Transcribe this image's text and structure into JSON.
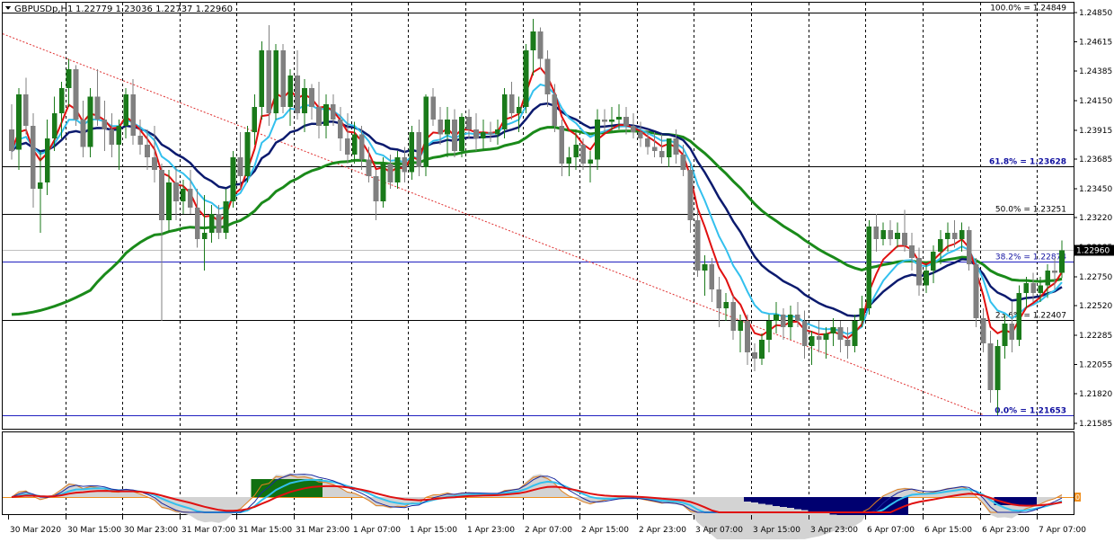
{
  "header": {
    "symbol_label": "GBPUSDp,H1",
    "ohlc_text": "1.22779 1.23036 1.22737 1.22960",
    "menu_arrow": "triangle-down-icon"
  },
  "colors": {
    "bull": "#1a7a1a",
    "bear": "#808080",
    "ma_fast": "#e01010",
    "ma_mid": "#33c0ee",
    "ma_slow": "#0b1a6e",
    "ma_long": "#1a8a1a",
    "trend": "#e03030",
    "fib_label": "#1010a0",
    "grid": "#000000"
  },
  "price_axis": {
    "ticks": [
      "1.24850",
      "1.24615",
      "1.24385",
      "1.24150",
      "1.23915",
      "1.23685",
      "1.23450",
      "1.23220",
      "1.22985",
      "1.22750",
      "1.22520",
      "1.22285",
      "1.22055",
      "1.21820",
      "1.21585"
    ],
    "current_price": "1.22960"
  },
  "time_axis": {
    "labels": [
      "30 Mar 2020",
      "30 Mar 15:00",
      "30 Mar 23:00",
      "31 Mar 07:00",
      "31 Mar 15:00",
      "31 Mar 23:00",
      "1 Apr 07:00",
      "1 Apr 15:00",
      "1 Apr 23:00",
      "2 Apr 07:00",
      "2 Apr 15:00",
      "2 Apr 23:00",
      "3 Apr 07:00",
      "3 Apr 15:00",
      "3 Apr 23:00",
      "6 Apr 07:00",
      "6 Apr 15:00",
      "6 Apr 23:00",
      "7 Apr 07:00"
    ]
  },
  "fibonacci": [
    {
      "label": "100.0% = 1.24849",
      "price": 1.24849
    },
    {
      "label": "61.8% = 1.23628",
      "price": 1.23628
    },
    {
      "label": "50.0% = 1.23251",
      "price": 1.23251
    },
    {
      "label": "38.2% = 1.22874",
      "price": 1.22874
    },
    {
      "label": "23.6% = 1.22407",
      "price": 1.22407
    },
    {
      "label": "0.0% = 1.21653",
      "price": 1.21653
    }
  ],
  "indicator": {
    "zero_label": "0"
  },
  "chart_data": {
    "type": "candlestick",
    "symbol": "GBPUSDp,H1",
    "y_range": [
      1.2155,
      1.2492
    ],
    "candles": [
      {
        "o": 1.2392,
        "h": 1.2412,
        "l": 1.2368,
        "c": 1.2375
      },
      {
        "o": 1.2376,
        "h": 1.2425,
        "l": 1.236,
        "c": 1.242
      },
      {
        "o": 1.242,
        "h": 1.2433,
        "l": 1.2388,
        "c": 1.2395
      },
      {
        "o": 1.2395,
        "h": 1.2405,
        "l": 1.233,
        "c": 1.2345
      },
      {
        "o": 1.2345,
        "h": 1.2375,
        "l": 1.231,
        "c": 1.235
      },
      {
        "o": 1.235,
        "h": 1.24,
        "l": 1.234,
        "c": 1.2385
      },
      {
        "o": 1.2385,
        "h": 1.2418,
        "l": 1.2375,
        "c": 1.2405
      },
      {
        "o": 1.2405,
        "h": 1.243,
        "l": 1.2385,
        "c": 1.2425
      },
      {
        "o": 1.2425,
        "h": 1.2448,
        "l": 1.241,
        "c": 1.244
      },
      {
        "o": 1.244,
        "h": 1.2443,
        "l": 1.2395,
        "c": 1.24
      },
      {
        "o": 1.24,
        "h": 1.2415,
        "l": 1.237,
        "c": 1.2378
      },
      {
        "o": 1.2378,
        "h": 1.2425,
        "l": 1.237,
        "c": 1.2418
      },
      {
        "o": 1.2418,
        "h": 1.244,
        "l": 1.2395,
        "c": 1.24
      },
      {
        "o": 1.24,
        "h": 1.2415,
        "l": 1.2375,
        "c": 1.2392
      },
      {
        "o": 1.2392,
        "h": 1.2405,
        "l": 1.237,
        "c": 1.238
      },
      {
        "o": 1.238,
        "h": 1.24,
        "l": 1.236,
        "c": 1.2395
      },
      {
        "o": 1.2395,
        "h": 1.2425,
        "l": 1.2385,
        "c": 1.242
      },
      {
        "o": 1.242,
        "h": 1.2432,
        "l": 1.238,
        "c": 1.2387
      },
      {
        "o": 1.2387,
        "h": 1.24,
        "l": 1.2372,
        "c": 1.238
      },
      {
        "o": 1.238,
        "h": 1.2392,
        "l": 1.236,
        "c": 1.237
      },
      {
        "o": 1.237,
        "h": 1.2395,
        "l": 1.235,
        "c": 1.236
      },
      {
        "o": 1.236,
        "h": 1.2365,
        "l": 1.224,
        "c": 1.232
      },
      {
        "o": 1.232,
        "h": 1.236,
        "l": 1.231,
        "c": 1.235
      },
      {
        "o": 1.235,
        "h": 1.2362,
        "l": 1.232,
        "c": 1.2335
      },
      {
        "o": 1.2335,
        "h": 1.2352,
        "l": 1.2325,
        "c": 1.2345
      },
      {
        "o": 1.2345,
        "h": 1.236,
        "l": 1.2325,
        "c": 1.233
      },
      {
        "o": 1.233,
        "h": 1.2345,
        "l": 1.2298,
        "c": 1.2305
      },
      {
        "o": 1.2305,
        "h": 1.234,
        "l": 1.228,
        "c": 1.231
      },
      {
        "o": 1.231,
        "h": 1.2332,
        "l": 1.2302,
        "c": 1.2325
      },
      {
        "o": 1.2325,
        "h": 1.2332,
        "l": 1.2305,
        "c": 1.231
      },
      {
        "o": 1.231,
        "h": 1.2345,
        "l": 1.2305,
        "c": 1.2335
      },
      {
        "o": 1.2335,
        "h": 1.2375,
        "l": 1.233,
        "c": 1.237
      },
      {
        "o": 1.237,
        "h": 1.239,
        "l": 1.2345,
        "c": 1.2355
      },
      {
        "o": 1.2355,
        "h": 1.2395,
        "l": 1.235,
        "c": 1.239
      },
      {
        "o": 1.239,
        "h": 1.242,
        "l": 1.238,
        "c": 1.241
      },
      {
        "o": 1.241,
        "h": 1.2462,
        "l": 1.24,
        "c": 1.2455
      },
      {
        "o": 1.2455,
        "h": 1.2475,
        "l": 1.2395,
        "c": 1.2405
      },
      {
        "o": 1.2405,
        "h": 1.246,
        "l": 1.24,
        "c": 1.2455
      },
      {
        "o": 1.2455,
        "h": 1.246,
        "l": 1.2405,
        "c": 1.241
      },
      {
        "o": 1.241,
        "h": 1.244,
        "l": 1.2395,
        "c": 1.2435
      },
      {
        "o": 1.2435,
        "h": 1.2455,
        "l": 1.24,
        "c": 1.2405
      },
      {
        "o": 1.2405,
        "h": 1.2432,
        "l": 1.239,
        "c": 1.2425
      },
      {
        "o": 1.2425,
        "h": 1.2428,
        "l": 1.24,
        "c": 1.241
      },
      {
        "o": 1.241,
        "h": 1.243,
        "l": 1.2385,
        "c": 1.2395
      },
      {
        "o": 1.2395,
        "h": 1.242,
        "l": 1.2385,
        "c": 1.2412
      },
      {
        "o": 1.2412,
        "h": 1.242,
        "l": 1.2395,
        "c": 1.24
      },
      {
        "o": 1.24,
        "h": 1.241,
        "l": 1.2375,
        "c": 1.2385
      },
      {
        "o": 1.2385,
        "h": 1.2405,
        "l": 1.2365,
        "c": 1.2372
      },
      {
        "o": 1.2372,
        "h": 1.2398,
        "l": 1.2365,
        "c": 1.2388
      },
      {
        "o": 1.2388,
        "h": 1.2395,
        "l": 1.236,
        "c": 1.2368
      },
      {
        "o": 1.2368,
        "h": 1.2378,
        "l": 1.235,
        "c": 1.2355
      },
      {
        "o": 1.2355,
        "h": 1.236,
        "l": 1.232,
        "c": 1.2335
      },
      {
        "o": 1.2335,
        "h": 1.237,
        "l": 1.233,
        "c": 1.2365
      },
      {
        "o": 1.2365,
        "h": 1.2372,
        "l": 1.2345,
        "c": 1.235
      },
      {
        "o": 1.235,
        "h": 1.2375,
        "l": 1.2345,
        "c": 1.237
      },
      {
        "o": 1.237,
        "h": 1.2378,
        "l": 1.235,
        "c": 1.2358
      },
      {
        "o": 1.2358,
        "h": 1.2395,
        "l": 1.2352,
        "c": 1.239
      },
      {
        "o": 1.239,
        "h": 1.24,
        "l": 1.2355,
        "c": 1.2362
      },
      {
        "o": 1.2362,
        "h": 1.242,
        "l": 1.2355,
        "c": 1.2418
      },
      {
        "o": 1.2418,
        "h": 1.2425,
        "l": 1.2395,
        "c": 1.24
      },
      {
        "o": 1.24,
        "h": 1.241,
        "l": 1.238,
        "c": 1.2388
      },
      {
        "o": 1.2388,
        "h": 1.241,
        "l": 1.237,
        "c": 1.24
      },
      {
        "o": 1.24,
        "h": 1.2408,
        "l": 1.237,
        "c": 1.2375
      },
      {
        "o": 1.2375,
        "h": 1.2405,
        "l": 1.237,
        "c": 1.2402
      },
      {
        "o": 1.2402,
        "h": 1.2408,
        "l": 1.2385,
        "c": 1.2392
      },
      {
        "o": 1.2392,
        "h": 1.2405,
        "l": 1.2375,
        "c": 1.2385
      },
      {
        "o": 1.2385,
        "h": 1.24,
        "l": 1.2375,
        "c": 1.239
      },
      {
        "o": 1.239,
        "h": 1.2398,
        "l": 1.2382,
        "c": 1.2388
      },
      {
        "o": 1.2388,
        "h": 1.24,
        "l": 1.238,
        "c": 1.2392
      },
      {
        "o": 1.2392,
        "h": 1.2425,
        "l": 1.2385,
        "c": 1.242
      },
      {
        "o": 1.242,
        "h": 1.243,
        "l": 1.24,
        "c": 1.2405
      },
      {
        "o": 1.2405,
        "h": 1.2418,
        "l": 1.239,
        "c": 1.241
      },
      {
        "o": 1.241,
        "h": 1.246,
        "l": 1.2405,
        "c": 1.2455
      },
      {
        "o": 1.2455,
        "h": 1.248,
        "l": 1.2435,
        "c": 1.247
      },
      {
        "o": 1.247,
        "h": 1.2473,
        "l": 1.244,
        "c": 1.2448
      },
      {
        "o": 1.2448,
        "h": 1.2455,
        "l": 1.241,
        "c": 1.242
      },
      {
        "o": 1.242,
        "h": 1.2428,
        "l": 1.239,
        "c": 1.2395
      },
      {
        "o": 1.2395,
        "h": 1.24,
        "l": 1.2355,
        "c": 1.2365
      },
      {
        "o": 1.2365,
        "h": 1.2378,
        "l": 1.2355,
        "c": 1.237
      },
      {
        "o": 1.237,
        "h": 1.2392,
        "l": 1.236,
        "c": 1.238
      },
      {
        "o": 1.238,
        "h": 1.2385,
        "l": 1.236,
        "c": 1.2365
      },
      {
        "o": 1.2365,
        "h": 1.2375,
        "l": 1.235,
        "c": 1.2368
      },
      {
        "o": 1.2368,
        "h": 1.2408,
        "l": 1.236,
        "c": 1.24
      },
      {
        "o": 1.24,
        "h": 1.2408,
        "l": 1.239,
        "c": 1.2398
      },
      {
        "o": 1.2398,
        "h": 1.241,
        "l": 1.239,
        "c": 1.24
      },
      {
        "o": 1.24,
        "h": 1.2412,
        "l": 1.2392,
        "c": 1.2402
      },
      {
        "o": 1.2402,
        "h": 1.241,
        "l": 1.2388,
        "c": 1.2395
      },
      {
        "o": 1.2395,
        "h": 1.2405,
        "l": 1.2385,
        "c": 1.239
      },
      {
        "o": 1.239,
        "h": 1.2398,
        "l": 1.2378,
        "c": 1.2385
      },
      {
        "o": 1.2385,
        "h": 1.2392,
        "l": 1.2372,
        "c": 1.2378
      },
      {
        "o": 1.2378,
        "h": 1.239,
        "l": 1.237,
        "c": 1.2375
      },
      {
        "o": 1.2375,
        "h": 1.2388,
        "l": 1.2365,
        "c": 1.237
      },
      {
        "o": 1.237,
        "h": 1.238,
        "l": 1.2362,
        "c": 1.2385
      },
      {
        "o": 1.2385,
        "h": 1.2392,
        "l": 1.2365,
        "c": 1.2372
      },
      {
        "o": 1.2372,
        "h": 1.238,
        "l": 1.2355,
        "c": 1.236
      },
      {
        "o": 1.236,
        "h": 1.2365,
        "l": 1.231,
        "c": 1.232
      },
      {
        "o": 1.232,
        "h": 1.2328,
        "l": 1.2275,
        "c": 1.228
      },
      {
        "o": 1.228,
        "h": 1.2292,
        "l": 1.226,
        "c": 1.2285
      },
      {
        "o": 1.2285,
        "h": 1.229,
        "l": 1.2255,
        "c": 1.2265
      },
      {
        "o": 1.2265,
        "h": 1.2275,
        "l": 1.2235,
        "c": 1.225
      },
      {
        "o": 1.225,
        "h": 1.2262,
        "l": 1.224,
        "c": 1.2255
      },
      {
        "o": 1.2255,
        "h": 1.226,
        "l": 1.2225,
        "c": 1.2232
      },
      {
        "o": 1.2232,
        "h": 1.2245,
        "l": 1.2215,
        "c": 1.224
      },
      {
        "o": 1.224,
        "h": 1.2245,
        "l": 1.2205,
        "c": 1.2215
      },
      {
        "o": 1.2215,
        "h": 1.2222,
        "l": 1.22,
        "c": 1.221
      },
      {
        "o": 1.221,
        "h": 1.223,
        "l": 1.2205,
        "c": 1.2225
      },
      {
        "o": 1.2225,
        "h": 1.2245,
        "l": 1.2215,
        "c": 1.224
      },
      {
        "o": 1.224,
        "h": 1.2255,
        "l": 1.223,
        "c": 1.2245
      },
      {
        "o": 1.2245,
        "h": 1.225,
        "l": 1.2225,
        "c": 1.2235
      },
      {
        "o": 1.2235,
        "h": 1.2252,
        "l": 1.2225,
        "c": 1.2245
      },
      {
        "o": 1.2245,
        "h": 1.2255,
        "l": 1.2235,
        "c": 1.224
      },
      {
        "o": 1.224,
        "h": 1.2248,
        "l": 1.221,
        "c": 1.222
      },
      {
        "o": 1.222,
        "h": 1.2232,
        "l": 1.2205,
        "c": 1.2228
      },
      {
        "o": 1.2228,
        "h": 1.224,
        "l": 1.2215,
        "c": 1.2225
      },
      {
        "o": 1.2225,
        "h": 1.2235,
        "l": 1.221,
        "c": 1.223
      },
      {
        "o": 1.223,
        "h": 1.2242,
        "l": 1.222,
        "c": 1.2235
      },
      {
        "o": 1.2235,
        "h": 1.224,
        "l": 1.2215,
        "c": 1.2225
      },
      {
        "o": 1.2225,
        "h": 1.2235,
        "l": 1.221,
        "c": 1.222
      },
      {
        "o": 1.222,
        "h": 1.2245,
        "l": 1.2215,
        "c": 1.224
      },
      {
        "o": 1.224,
        "h": 1.226,
        "l": 1.2235,
        "c": 1.225
      },
      {
        "o": 1.225,
        "h": 1.232,
        "l": 1.2245,
        "c": 1.2315
      },
      {
        "o": 1.2315,
        "h": 1.2325,
        "l": 1.2295,
        "c": 1.2305
      },
      {
        "o": 1.2305,
        "h": 1.2318,
        "l": 1.23,
        "c": 1.2312
      },
      {
        "o": 1.2312,
        "h": 1.232,
        "l": 1.23,
        "c": 1.2305
      },
      {
        "o": 1.2305,
        "h": 1.2318,
        "l": 1.2298,
        "c": 1.231
      },
      {
        "o": 1.231,
        "h": 1.2328,
        "l": 1.2295,
        "c": 1.23
      },
      {
        "o": 1.23,
        "h": 1.231,
        "l": 1.228,
        "c": 1.229
      },
      {
        "o": 1.229,
        "h": 1.2298,
        "l": 1.226,
        "c": 1.2268
      },
      {
        "o": 1.2268,
        "h": 1.2285,
        "l": 1.2262,
        "c": 1.228
      },
      {
        "o": 1.228,
        "h": 1.23,
        "l": 1.227,
        "c": 1.2295
      },
      {
        "o": 1.2295,
        "h": 1.2312,
        "l": 1.2285,
        "c": 1.2305
      },
      {
        "o": 1.2305,
        "h": 1.2318,
        "l": 1.2295,
        "c": 1.231
      },
      {
        "o": 1.231,
        "h": 1.232,
        "l": 1.2298,
        "c": 1.2305
      },
      {
        "o": 1.2305,
        "h": 1.2318,
        "l": 1.2295,
        "c": 1.2312
      },
      {
        "o": 1.2312,
        "h": 1.2315,
        "l": 1.228,
        "c": 1.2285
      },
      {
        "o": 1.2285,
        "h": 1.229,
        "l": 1.2235,
        "c": 1.2242
      },
      {
        "o": 1.2242,
        "h": 1.225,
        "l": 1.2215,
        "c": 1.2222
      },
      {
        "o": 1.2222,
        "h": 1.2232,
        "l": 1.2175,
        "c": 1.2185
      },
      {
        "o": 1.2185,
        "h": 1.2225,
        "l": 1.2165,
        "c": 1.222
      },
      {
        "o": 1.222,
        "h": 1.2245,
        "l": 1.221,
        "c": 1.2238
      },
      {
        "o": 1.2238,
        "h": 1.2255,
        "l": 1.2215,
        "c": 1.2225
      },
      {
        "o": 1.2225,
        "h": 1.2268,
        "l": 1.222,
        "c": 1.2262
      },
      {
        "o": 1.2262,
        "h": 1.2275,
        "l": 1.225,
        "c": 1.227
      },
      {
        "o": 1.227,
        "h": 1.2278,
        "l": 1.2255,
        "c": 1.2262
      },
      {
        "o": 1.2262,
        "h": 1.2275,
        "l": 1.2255,
        "c": 1.2268
      },
      {
        "o": 1.2268,
        "h": 1.2285,
        "l": 1.2258,
        "c": 1.228
      },
      {
        "o": 1.228,
        "h": 1.229,
        "l": 1.2265,
        "c": 1.2278
      },
      {
        "o": 1.2278,
        "h": 1.2304,
        "l": 1.2274,
        "c": 1.2296
      }
    ]
  }
}
